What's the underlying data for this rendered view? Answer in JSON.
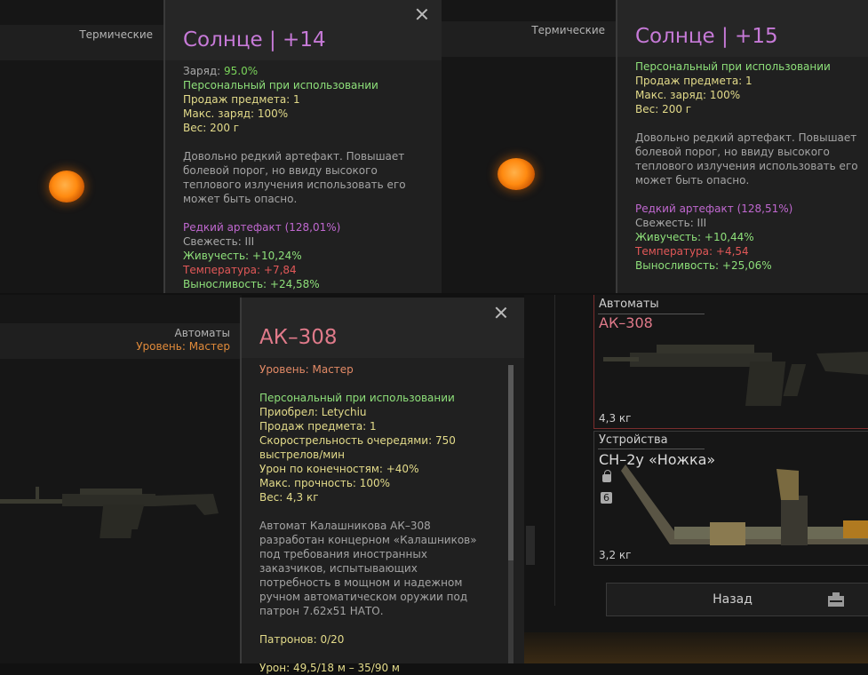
{
  "artifact1": {
    "category": "Термические",
    "title": "Солнце | +14",
    "stats": [
      {
        "label": "Заряд: ",
        "value": "95.0%",
        "color": "mixed"
      },
      {
        "label": "Персональный при использовании",
        "color": "green"
      },
      {
        "label": "Продаж предмета: 1",
        "color": "yellow"
      },
      {
        "label": "Макс. заряд: 100%",
        "color": "yellow"
      },
      {
        "label": "Вес: 200 г",
        "color": "yellow"
      }
    ],
    "description": "Довольно редкий артефакт. Повышает болевой порог, но ввиду высокого теплового излучения использовать его может быть опасно.",
    "rarity": "Редкий артефакт (128,01%)",
    "freshness": "Свежесть: III",
    "vitality": "Живучесть: +10,24%",
    "temperature": "Температура: +7,84",
    "stamina": "Выносливость: +24,58%"
  },
  "artifact2": {
    "category": "Термические",
    "title": "Солнце | +15",
    "personal": "Персональный при использовании",
    "sales": "Продаж предмета: 1",
    "max_charge": "Макс. заряд: 100%",
    "weight": "Вес: 200 г",
    "description": "Довольно редкий артефакт. Повышает болевой порог, но ввиду высокого теплового излучения использовать его может быть опасно.",
    "rarity": "Редкий артефакт (128,51%)",
    "freshness": "Свежесть: III",
    "vitality": "Живучесть: +10,44%",
    "temperature": "Температура: +4,54",
    "stamina": "Выносливость: +25,06%"
  },
  "weapon": {
    "category": "Автоматы",
    "level_side": "Уровень: Мастер",
    "title": "АК–308",
    "level": "Уровень: Мастер",
    "personal": "Персональный при использовании",
    "acquired": "Приобрел: Letychiu",
    "sales": "Продаж предмета: 1",
    "rate_line1": "Скорострельность очередями: 750",
    "rate_line2": "выстрелов/мин",
    "limb_damage": "Урон по конечностям: +40%",
    "durability": "Макс. прочность: 100%",
    "weight": "Вес: 4,3 кг",
    "description": "Автомат Калашникова АК–308 разработан концерном «Калашников» под требования иностранных заказчиков, испытывающих потребность в мощном и надежном ручном автоматическом оружии под патрон 7.62x51 НАТО.",
    "ammo": "Патронов: 0/20",
    "damage": "Урон: 49,5/18 м – 35/90 м"
  },
  "inventory": {
    "card1": {
      "category": "Автоматы",
      "name": "АК–308",
      "weight": "4,3 кг"
    },
    "card2": {
      "category": "Устройства",
      "name": "СН–2у «Ножка»",
      "weight": "3,2 кг",
      "badge": "6"
    },
    "back_button": "Назад"
  },
  "colors": {
    "purple": "#c068d0",
    "green": "#8ee07a",
    "yellow": "#e3db8a",
    "red": "#e25858",
    "title_pink": "#e07a8a"
  }
}
